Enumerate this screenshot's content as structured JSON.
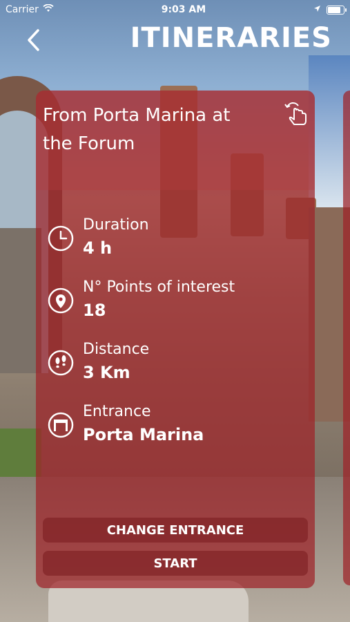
{
  "status_bar": {
    "carrier": "Carrier",
    "time": "9:03 AM",
    "icons": [
      "wifi-icon",
      "location-arrow-icon",
      "battery-icon"
    ]
  },
  "header": {
    "back_icon": "chevron-left-icon",
    "title": "ITINERARIES"
  },
  "itinerary_card": {
    "title": "From Porta Marina at the Forum",
    "swipe_icon": "swipe-hand-icon",
    "info": [
      {
        "icon": "clock-icon",
        "label": "Duration",
        "value": "4 h"
      },
      {
        "icon": "map-pin-icon",
        "label": "N° Points of interest",
        "value": "18"
      },
      {
        "icon": "footsteps-icon",
        "label": "Distance",
        "value": "3 Km"
      },
      {
        "icon": "gate-icon",
        "label": "Entrance",
        "value": "Porta Marina"
      }
    ],
    "buttons": {
      "change_entrance": "CHANGE ENTRANCE",
      "start": "START"
    }
  },
  "colors": {
    "card": "#9E2328",
    "button": "#781A1E",
    "text": "#FFFFFF"
  }
}
